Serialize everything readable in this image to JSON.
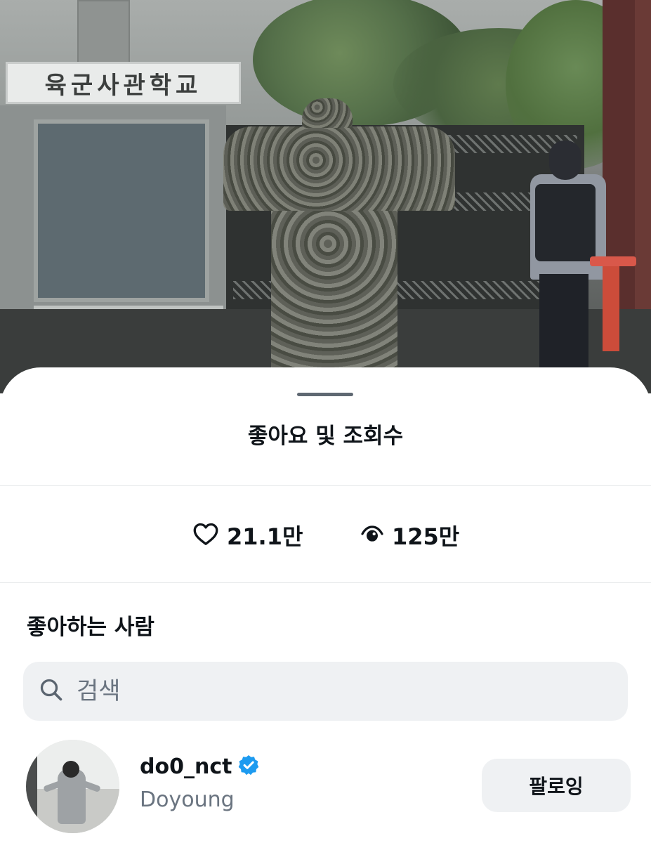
{
  "background_photo": {
    "sign_text": "육군사관학교"
  },
  "sheet": {
    "title": "좋아요 및 조회수"
  },
  "stats": {
    "likes": {
      "icon": "heart-outline-icon",
      "value": "21.1만"
    },
    "views": {
      "icon": "eye-icon",
      "value": "125만"
    }
  },
  "likers": {
    "section_title": "좋아하는 사람",
    "search": {
      "icon": "search-icon",
      "placeholder": "검색",
      "value": ""
    },
    "users": [
      {
        "handle": "do0_nct",
        "display_name": "Doyoung",
        "verified": true,
        "badge_icon": "verified-badge-icon",
        "badge_color": "#1d9bf0",
        "button_label": "팔로잉"
      }
    ]
  }
}
